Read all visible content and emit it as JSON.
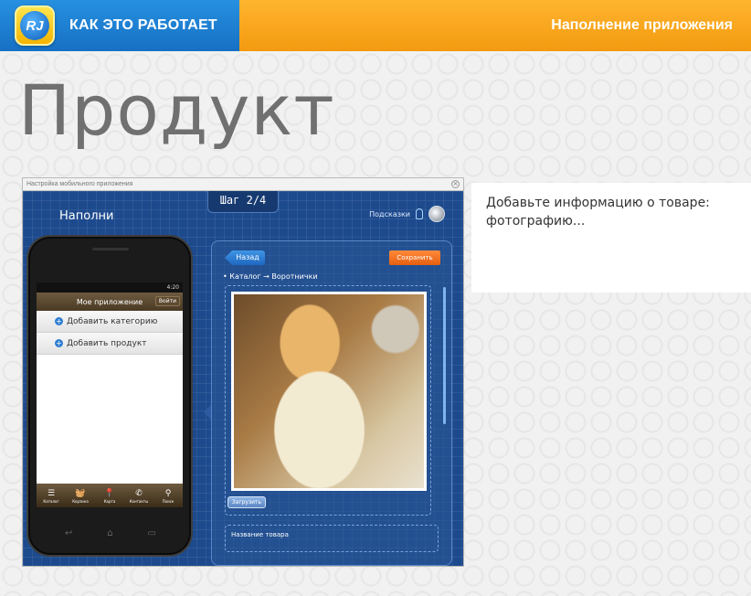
{
  "header": {
    "logo_text": "RJ",
    "title": "КАК ЭТО РАБОТАЕТ",
    "section": "Наполнение приложения"
  },
  "page_title": "Продукт",
  "window": {
    "title": "Настройка мобильного приложения",
    "step": "Шаг 2/4",
    "fill_title": "Наполни",
    "hints_label": "Подсказки"
  },
  "phone": {
    "status_time": "4:20",
    "app_title": "Мое приложение",
    "login": "Войти",
    "items": [
      "Добавить категорию",
      "Добавить продукт"
    ],
    "tabs": [
      {
        "glyph": "☰",
        "label": "Каталог"
      },
      {
        "glyph": "🧺",
        "label": "Корзина"
      },
      {
        "glyph": "📍",
        "label": "Карта"
      },
      {
        "glyph": "✆",
        "label": "Контакты"
      },
      {
        "glyph": "⚲",
        "label": "Поиск"
      }
    ]
  },
  "editor": {
    "back": "Назад",
    "save": "Сохранить",
    "breadcrumb": "• Каталог → Воротнички",
    "upload": "Загрузить",
    "name_label": "Название товара"
  },
  "description": "Добавьте информацию о товаре: фотографию..."
}
